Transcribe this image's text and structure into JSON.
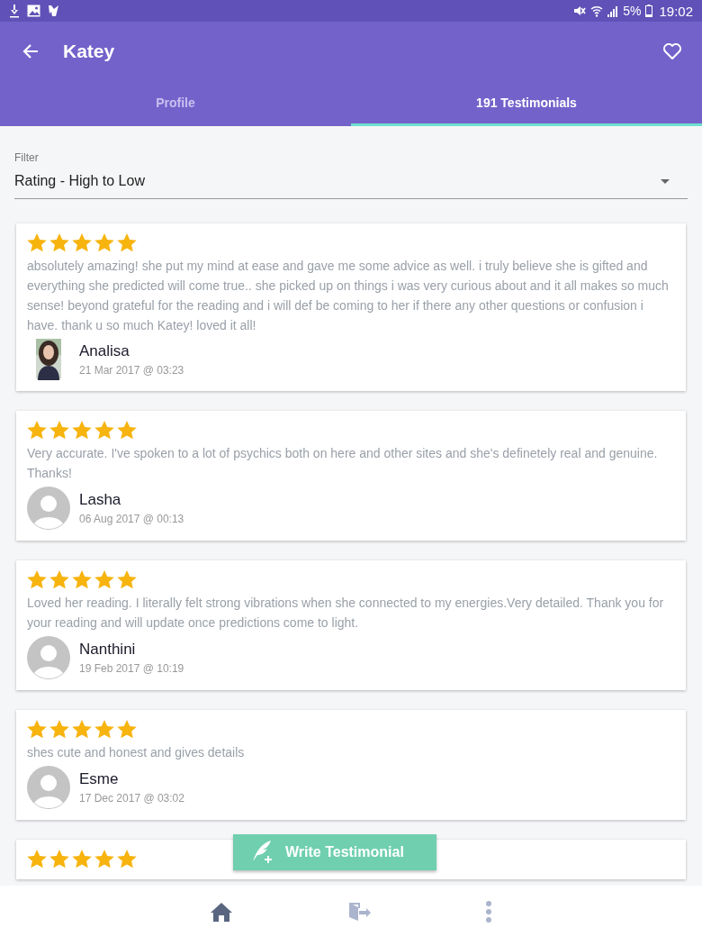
{
  "status_bar": {
    "battery": "5%",
    "time": "19:02"
  },
  "app_bar": {
    "title": "Katey"
  },
  "tabs": [
    {
      "label": "Profile",
      "selected": false
    },
    {
      "label": "191 Testimonials",
      "selected": true
    }
  ],
  "filter": {
    "label": "Filter",
    "value": "Rating - High to Low"
  },
  "reviews": [
    {
      "stars": 5,
      "text": "absolutely amazing! she put my mind at ease and gave me some advice as well. i truly believe she is gifted and everything she predicted will come true.. she picked up on things i was very curious about and it all makes so much sense! beyond grateful for the reading and i will def be coming to her if there any other questions or confusion i have. thank u so much Katey! loved it all!",
      "has_photo": true,
      "name": "Analisa",
      "date": "21 Mar 2017 @ 03:23"
    },
    {
      "stars": 5,
      "text": "Very accurate. I've spoken to a lot of psychics both on here and other sites and she's definetely real and genuine. Thanks!",
      "has_photo": false,
      "name": "Lasha",
      "date": "06 Aug 2017 @ 00:13"
    },
    {
      "stars": 5,
      "text": "Loved her reading. I literally felt strong vibrations when she connected to my energies.Very detailed. Thank you for your reading and will update once predictions come to light.",
      "has_photo": false,
      "name": "Nanthini",
      "date": "19 Feb 2017 @ 10:19"
    },
    {
      "stars": 5,
      "text": "shes cute and honest and gives details",
      "has_photo": false,
      "name": "Esme",
      "date": "17 Dec 2017 @ 03:02"
    },
    {
      "stars": 5
    }
  ],
  "write_button": {
    "label": "Write Testimonial"
  }
}
